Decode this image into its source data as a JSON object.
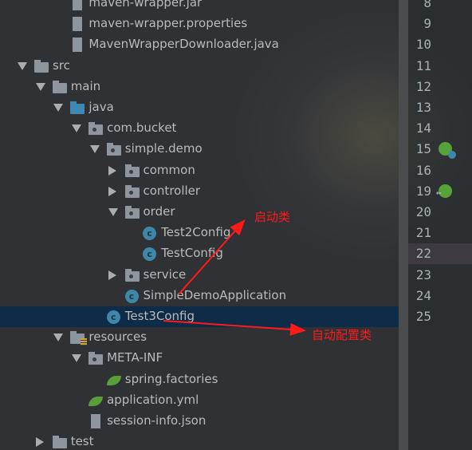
{
  "tree": [
    {
      "label": "maven-wrapper.jar",
      "level": 3,
      "icon": "jar-file-icon",
      "expand": null
    },
    {
      "label": "maven-wrapper.properties",
      "level": 3,
      "icon": "properties-file-icon",
      "expand": null
    },
    {
      "label": "MavenWrapperDownloader.java",
      "level": 3,
      "icon": "java-file-icon",
      "expand": null
    },
    {
      "label": "src",
      "level": 1,
      "icon": "folder-icon",
      "expand": "down"
    },
    {
      "label": "main",
      "level": 2,
      "icon": "folder-icon",
      "expand": "down"
    },
    {
      "label": "java",
      "level": 3,
      "icon": "source-folder-icon",
      "expand": "down"
    },
    {
      "label": "com.bucket",
      "level": 4,
      "icon": "package-icon",
      "expand": "down"
    },
    {
      "label": "simple.demo",
      "level": 5,
      "icon": "package-icon",
      "expand": "down"
    },
    {
      "label": "common",
      "level": 6,
      "icon": "package-icon",
      "expand": "right"
    },
    {
      "label": "controller",
      "level": 6,
      "icon": "package-icon",
      "expand": "right"
    },
    {
      "label": "order",
      "level": 6,
      "icon": "package-icon",
      "expand": "down"
    },
    {
      "label": "Test2Config",
      "level": 7,
      "icon": "class-icon",
      "expand": null
    },
    {
      "label": "TestConfig",
      "level": 7,
      "icon": "class-icon",
      "expand": null
    },
    {
      "label": "service",
      "level": 6,
      "icon": "package-icon",
      "expand": "right"
    },
    {
      "label": "SimpleDemoApplication",
      "level": 6,
      "icon": "spring-boot-class-icon",
      "expand": null
    },
    {
      "label": "Test3Config",
      "level": 5,
      "icon": "class-icon",
      "expand": null,
      "selected": true
    },
    {
      "label": "resources",
      "level": 3,
      "icon": "resources-folder-icon",
      "expand": "down"
    },
    {
      "label": "META-INF",
      "level": 4,
      "icon": "package-icon",
      "expand": "down"
    },
    {
      "label": "spring.factories",
      "level": 5,
      "icon": "spring-factories-icon",
      "expand": null
    },
    {
      "label": "application.yml",
      "level": 4,
      "icon": "spring-config-icon",
      "expand": null
    },
    {
      "label": "session-info.json",
      "level": 4,
      "icon": "json-file-icon",
      "expand": null
    },
    {
      "label": "test",
      "level": 2,
      "icon": "folder-icon",
      "expand": "right"
    }
  ],
  "gutter": {
    "line_numbers": [
      "8",
      "9",
      "10",
      "11",
      "12",
      "13",
      "14",
      "15",
      "16",
      "19",
      "20",
      "21",
      "22",
      "23",
      "24",
      "25"
    ],
    "current_line": "22",
    "markers": {
      "15": "spring-bean-icon",
      "19": "spring-navigate-back-icon"
    }
  },
  "annotations": {
    "startup_class": "启动类",
    "auto_config_class": "自动配置类",
    "color": "#ff1a1a"
  },
  "colors": {
    "selection": "#0e2b47",
    "class_icon": "#3e87a9",
    "spring_green": "#56a33a"
  }
}
